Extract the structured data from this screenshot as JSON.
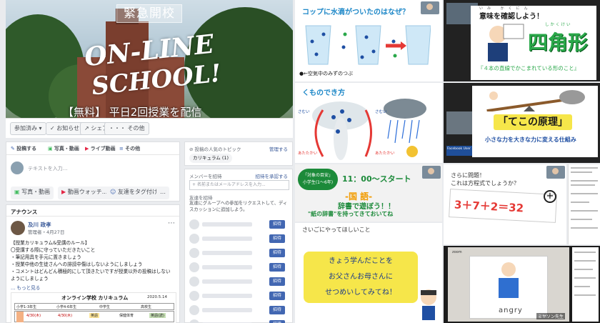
{
  "facebook": {
    "cover_badge": "緊急開校",
    "cover_title_1": "ON-LINE",
    "cover_title_2": "SCHOOL!",
    "cover_subtitle": "【無料】 平日2回授業を配信",
    "btn_join": "参加済み",
    "btn_notify": "お知らせ",
    "btn_share": "シェア",
    "btn_more": "・・・ その他",
    "composer_tabs": [
      "投稿する",
      "写真・動画",
      "ライブ動画",
      "その他"
    ],
    "composer_placeholder": "テキストを入力...",
    "composer_actions": [
      "写真・動画",
      "動画ウォッチ...",
      "友達をタグ付け"
    ],
    "popular_topics": "投稿の人気のトピック",
    "manage": "管理する",
    "topic_chip": "カリキュラム (1)",
    "invite_members": "メンバーを招待",
    "invite_link": "招待を承認する",
    "invite_placeholder": "名前またはメールアドレスを入力...",
    "friend_invite": "友達を招待",
    "friend_invite_desc": "友達にグループへの参加をリクエストして、ディスカッションに追加しよう。",
    "invite_btn": "招待",
    "announce": "アナウンス",
    "post_author": "及川 政孝",
    "post_meta": "管理者・4月27日",
    "post_lines": [
      "【授業カリキュラム&受講のルール】",
      "〇受講する際に守っていただきたいこと",
      "・筆記用具を手元に置きましょう",
      "・授業中他の生徒さんへの誹謗中傷はしないようにしましょう",
      "・コメントはどんどん積極的にして頂きたいですが授業以外の投稿はしない",
      "ようにしましょう"
    ],
    "read_more": "... もっと見る",
    "curriculum_title": "オンライン学校 カリキュラム",
    "curriculum_date": "2020.5.14",
    "table_headers": [
      "小学1-3年生",
      "小学4-6年生",
      "中学生",
      "高校生"
    ],
    "table_cells": [
      "4/30(木)",
      "4/30(木)",
      "英語",
      "保健体育",
      "英語(読)"
    ]
  },
  "slides": {
    "s1_title": "コップに水滴がついたのはなぜ？",
    "s1_caption": "●←空気中のみずのつぶ",
    "s2_title": "くものでき方",
    "s2_labels": [
      "さむい",
      "あたたかい",
      "さむい",
      "あたたかい"
    ],
    "s3_title": "意味を確認しよう！",
    "s3_ruby": "いみ かくにん",
    "s3_word": "四角形",
    "s3_word_ruby": "しかくけい",
    "s3_desc": "『４本の直線でかこまれている形のこと』",
    "s4_title": "「てこの原理」",
    "s4_desc": "小さな力を大きな力に変える仕組み",
    "s5_badge_1": "「対象の目安」",
    "s5_badge_2": "小学生(1〜6年)",
    "s5_time": "11：00〜スタート",
    "s5_subject": "-国 語-",
    "s5_line1": "辞書で遊ぼう！！",
    "s5_line2": "\"紙の辞書\"を持ってきておいてね",
    "s6_title_1": "さらに問題！",
    "s6_title_2": "これは方程式でしょうか？",
    "s6_equation": "3＋7＋2＝32",
    "s7_header": "さいごにやってほしいこと",
    "s7_lines": [
      "きょう学んだことを",
      "お父さんお母さんに",
      "せつめいしてみてね！"
    ],
    "s8_card_word": "angry",
    "s8_name": "ミヤソン先生",
    "fb_user": "Facebook User",
    "zoom": "zoom"
  }
}
